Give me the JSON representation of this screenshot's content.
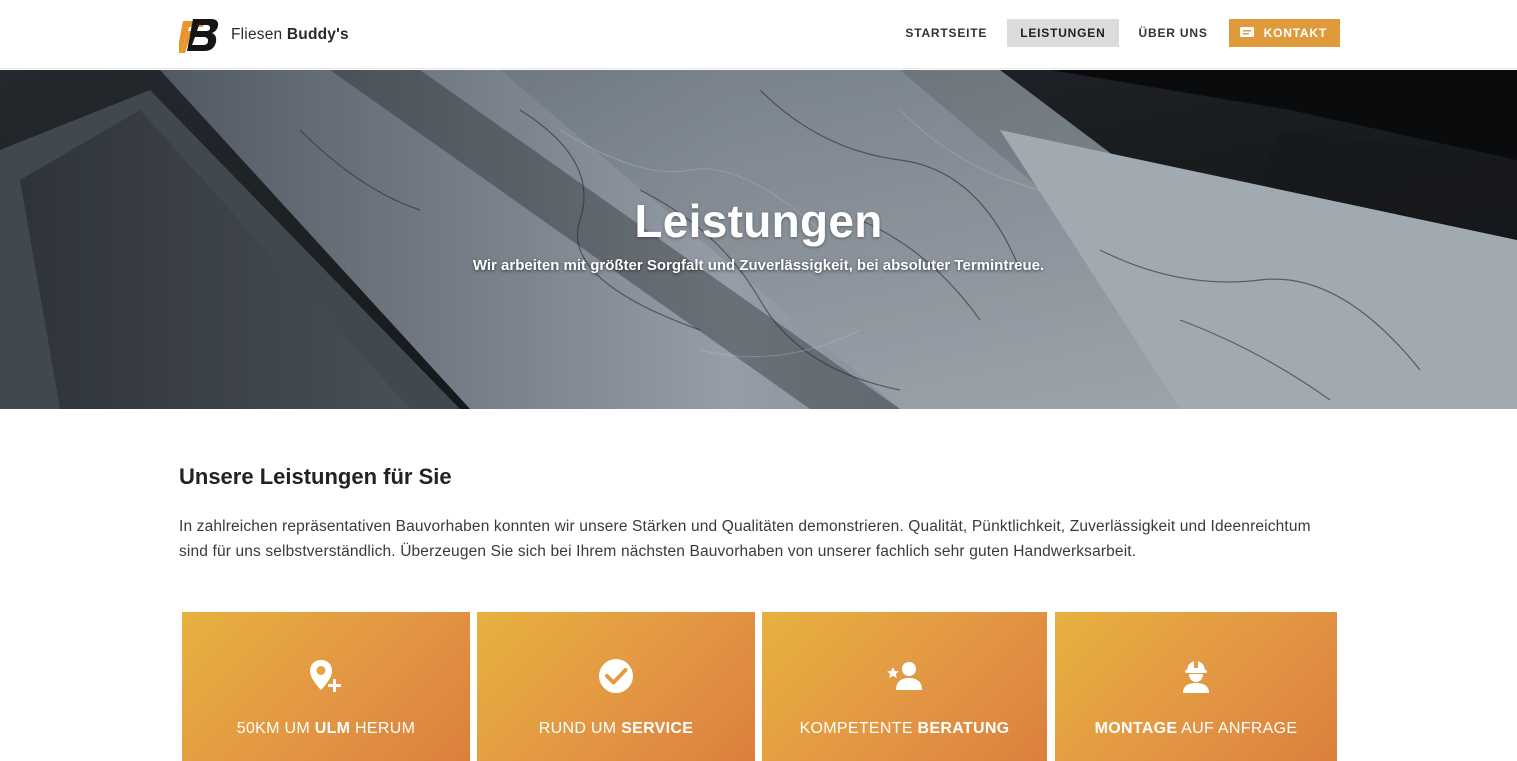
{
  "header": {
    "brand_light": "Fliesen",
    "brand_bold": "Buddy's",
    "logo_letters": "FB",
    "nav": {
      "home": "STARTSEITE",
      "services": "LEISTUNGEN",
      "about": "ÜBER UNS",
      "contact": "KONTAKT"
    }
  },
  "hero": {
    "title": "Leistungen",
    "subtitle": "Wir arbeiten mit größter Sorgfalt und Zuverlässigkeit, bei absoluter Termintreue."
  },
  "intro": {
    "title_bold": "Unsere Leistungen",
    "title_light": "für Sie",
    "text": "In zahlreichen repräsentativen Bauvorhaben konnten wir unsere Stärken und Qualitäten demonstrieren. Qualität, Pünktlichkeit, Zuverlässigkeit und Ideen­reichtum sind für uns selbstverständlich. Überzeugen Sie sich bei Ihrem nächsten Bauvorhaben von unserer fachlich sehr guten Handwerksarbeit."
  },
  "cards": [
    {
      "icon": "location-plus-icon",
      "pre": "50KM UM ",
      "bold": "ULM",
      "post": " HERUM"
    },
    {
      "icon": "check-circle-icon",
      "pre": "RUND UM ",
      "bold": "SERVICE",
      "post": ""
    },
    {
      "icon": "user-star-icon",
      "pre": "KOMPETENTE ",
      "bold": "BERATUNG",
      "post": ""
    },
    {
      "icon": "worker-icon",
      "pre": "",
      "bold": "MONTAGE",
      "post": " AUF ANFRAGE"
    }
  ],
  "colors": {
    "accent": "#e09a3b",
    "card_gradient_start": "#e8b13f",
    "card_gradient_end": "#da803d",
    "nav_active_bg": "#dcdcdc"
  }
}
